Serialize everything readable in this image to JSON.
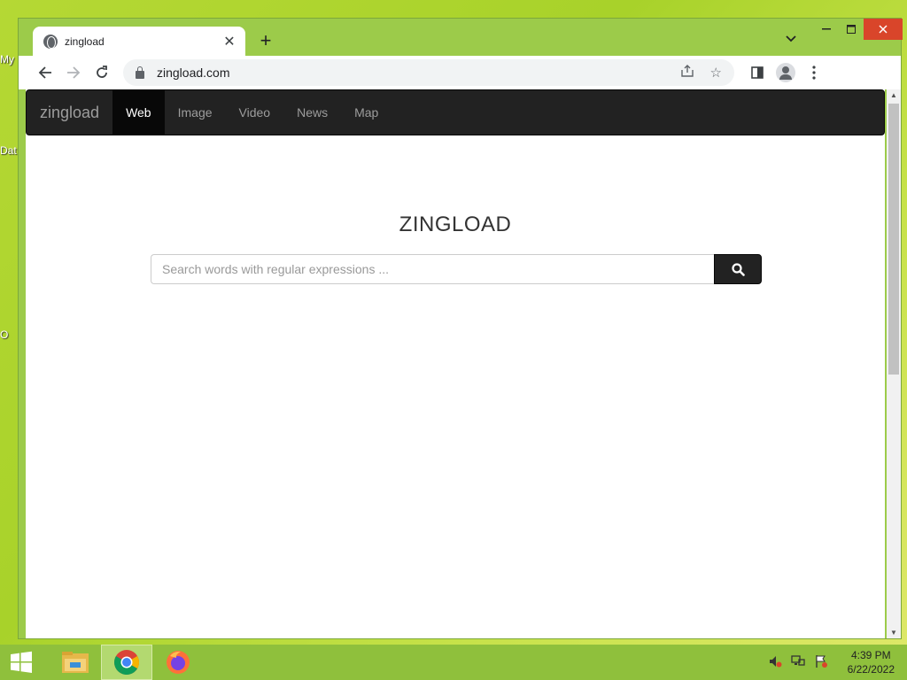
{
  "browser": {
    "tab_title": "zingload",
    "url": "zingload.com",
    "icons": {
      "globe": "globe-icon",
      "close": "close-icon",
      "new_tab": "plus-icon",
      "back": "back-arrow-icon",
      "forward": "forward-arrow-icon",
      "reload": "reload-icon",
      "lock": "lock-icon",
      "share": "share-icon",
      "bookmark": "star-icon",
      "side_panel": "side-panel-icon",
      "profile": "profile-icon",
      "menu": "kebab-menu-icon"
    }
  },
  "site": {
    "brand": "zingload",
    "nav": [
      {
        "label": "Web",
        "active": true
      },
      {
        "label": "Image",
        "active": false
      },
      {
        "label": "Video",
        "active": false
      },
      {
        "label": "News",
        "active": false
      },
      {
        "label": "Map",
        "active": false
      }
    ],
    "title": "ZINGLOAD",
    "search": {
      "placeholder": "Search words with regular expressions ...",
      "value": ""
    }
  },
  "desktop": {
    "labels": [
      "My",
      "Dat",
      "O"
    ]
  },
  "taskbar": {
    "time": "4:39 PM",
    "date": "6/22/2022",
    "apps": [
      "file-explorer-icon",
      "chrome-icon",
      "firefox-icon"
    ]
  },
  "colors": {
    "desktop_bg": "#a8d22a",
    "window_frame": "#9ccb4a",
    "navbar_bg": "#222222",
    "close_button": "#d9452a"
  }
}
